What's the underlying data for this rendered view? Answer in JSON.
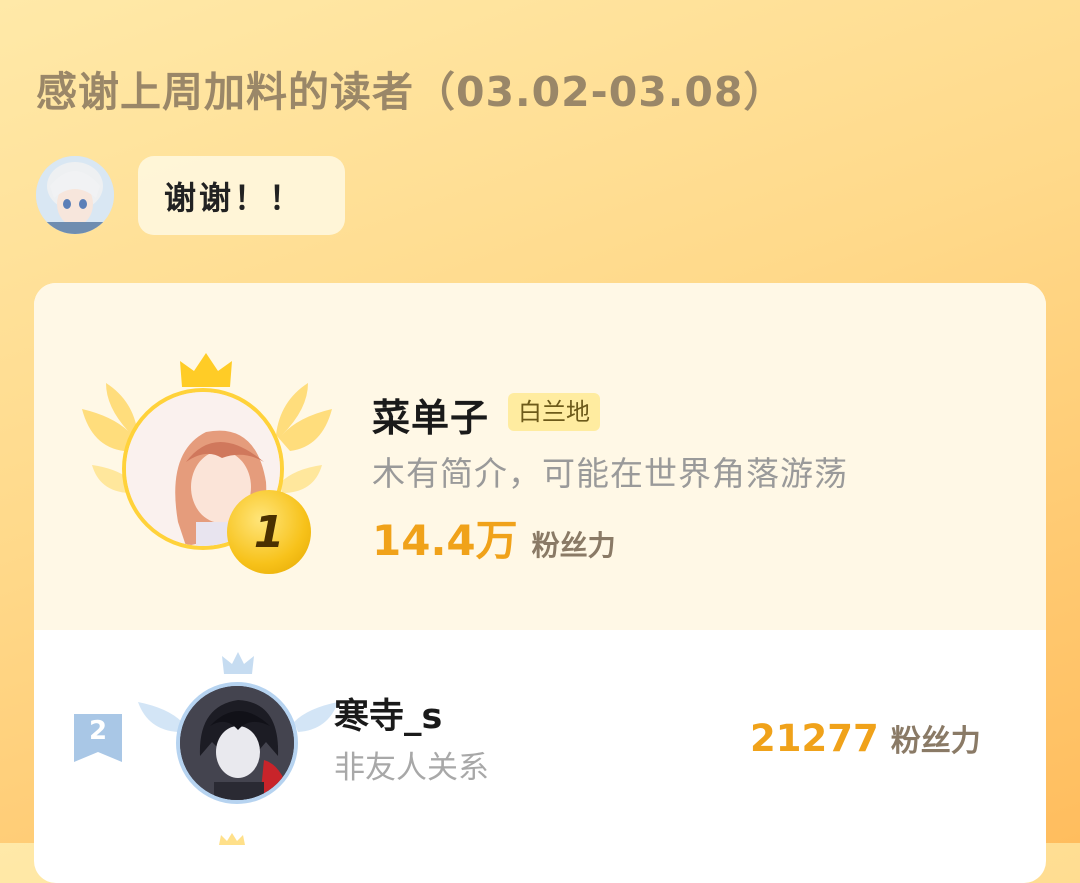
{
  "header": {
    "title": "感谢上周加料的读者（03.02-03.08）"
  },
  "message": {
    "text": "谢谢！！"
  },
  "leaderboard": {
    "first": {
      "rank": "1",
      "name": "菜单子",
      "tag": "白兰地",
      "bio": "木有简介，可能在世界角落游荡",
      "fans_value": "14.4万",
      "fans_label": "粉丝力"
    },
    "second": {
      "rank": "2",
      "name": "寒寺_s",
      "subtitle": "非友人关系",
      "fans_value": "21277",
      "fans_label": "粉丝力"
    }
  },
  "colors": {
    "accent_gold": "#f0a21a",
    "rank1_ring": "#ffd23a",
    "rank2_ring": "#b6d3f0"
  },
  "icons": [
    "crown-icon",
    "wings-icon",
    "rank-1-medal",
    "rank-2-ribbon"
  ]
}
